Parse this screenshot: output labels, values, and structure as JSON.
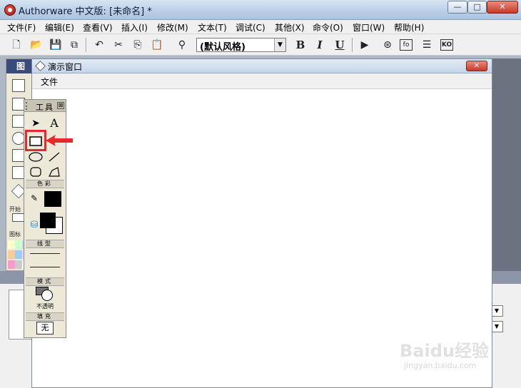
{
  "app": {
    "title": "Authorware 中文版: [未命名] *",
    "window_controls": {
      "minimize": "—",
      "maximize": "□",
      "close": "✕"
    }
  },
  "menubar": {
    "items": [
      "文件(F)",
      "编辑(E)",
      "查看(V)",
      "插入(I)",
      "修改(M)",
      "文本(T)",
      "调试(C)",
      "其他(X)",
      "命令(O)",
      "窗口(W)",
      "帮助(H)"
    ]
  },
  "toolbar": {
    "style_select": {
      "value": "(默认风格)"
    },
    "format_buttons": {
      "bold": "B",
      "italic": "I",
      "underline": "U"
    },
    "icons": [
      "new-file-icon",
      "open-folder-icon",
      "save-all-icon",
      "import-icon",
      "undo-icon",
      "cut-icon",
      "copy-icon",
      "paste-icon",
      "find-icon",
      "run-icon",
      "restart-icon",
      "functions-icon",
      "variables-icon",
      "knowledge-objects-icon"
    ],
    "function_label": "fo",
    "ko_label": "KO"
  },
  "icon_palette": {
    "header": "图标",
    "label_start": "开始",
    "label_icon_color": "图标"
  },
  "presentation_window": {
    "title": "演示窗口",
    "menu_file": "文件",
    "close": "✕"
  },
  "tools": {
    "title": "工具",
    "close": "⊠",
    "text_tool": "A",
    "sections": {
      "color": "色彩",
      "line": "线型",
      "mode": "模式",
      "fill": "填充"
    },
    "mode_value": "不透明",
    "fill_value": "无",
    "highlighted_tool": "rectangle-tool"
  },
  "colors": {
    "highlight": "#e8282b",
    "arrow": "#e8282b"
  },
  "watermark": {
    "logo": "Baidu经验",
    "sub": "jingyan.baidu.com"
  }
}
